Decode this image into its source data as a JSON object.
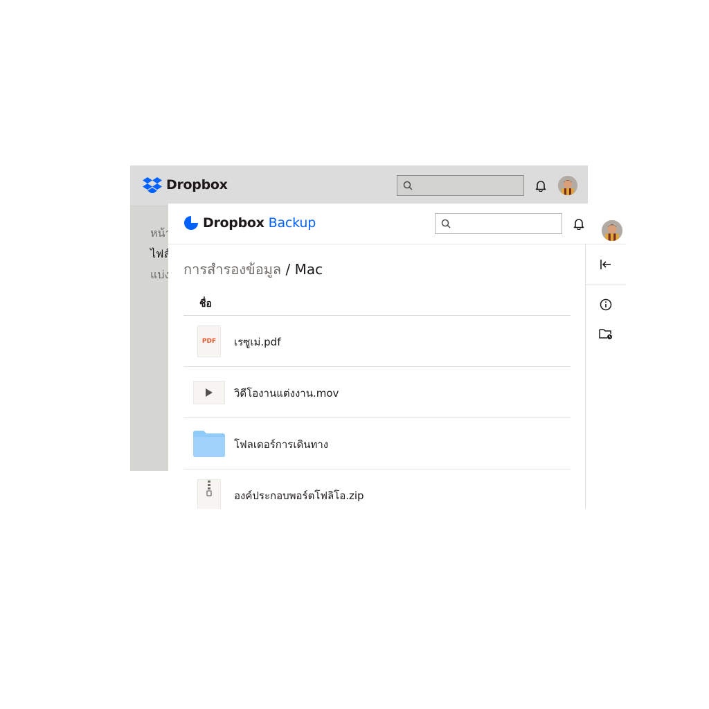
{
  "back_window": {
    "brand": "Dropbox",
    "nav": [
      "หน้า",
      "ไฟล์",
      "แบ่ง"
    ]
  },
  "front_window": {
    "brand": "Dropbox",
    "product": "Backup",
    "breadcrumb": {
      "root": "การสำรองข้อมูล",
      "separator": "/",
      "current": "Mac"
    },
    "column_header": "ชื่อ",
    "files": [
      {
        "name": "เรซูเม่.pdf",
        "type": "pdf",
        "badge": "PDF"
      },
      {
        "name": "วิดีโองานแต่งงาน.mov",
        "type": "video"
      },
      {
        "name": "โฟลเดอร์การเดินทาง",
        "type": "folder"
      },
      {
        "name": "องค์ประกอบพอร์ตโฟลิโอ.zip",
        "type": "zip"
      }
    ],
    "side_rail": [
      "collapse-panel-icon",
      "info-icon",
      "folder-backup-icon"
    ]
  },
  "colors": {
    "brand_blue": "#0061fe",
    "pdf_orange": "#e8562d",
    "folder_blue": "#90caf9"
  }
}
